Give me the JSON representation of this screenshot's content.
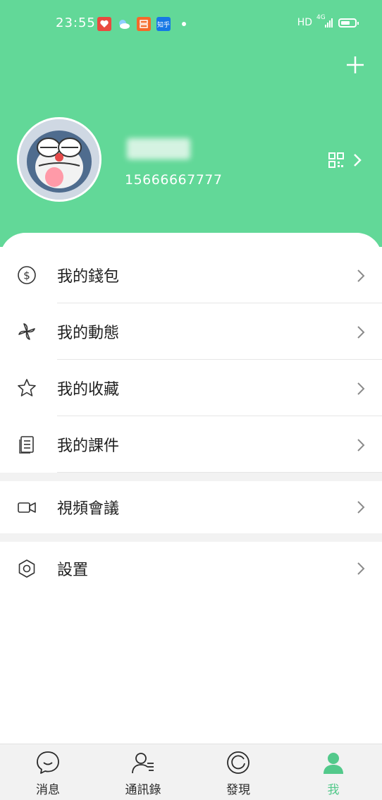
{
  "status_bar": {
    "time": "23:55",
    "notification_icons": [
      {
        "name": "red-app-icon",
        "color": "#e94a3f"
      },
      {
        "name": "weather-icon",
        "color": "#5aa8e6"
      },
      {
        "name": "orange-app-icon",
        "color": "#f46a2b"
      },
      {
        "name": "zhihu-icon",
        "label": "知乎",
        "color": "#1678e5"
      }
    ],
    "network": "HD",
    "signal_label": "4G"
  },
  "header": {
    "add_icon": "plus-icon",
    "phone": "15666667777",
    "qr_icon": "qr-code-icon",
    "chevron_icon": "chevron-right-icon",
    "background_color": "#62d898"
  },
  "menu": {
    "group1": [
      {
        "label": "我的錢包",
        "icon": "wallet-dollar-icon"
      },
      {
        "label": "我的動態",
        "icon": "pinwheel-icon"
      },
      {
        "label": "我的收藏",
        "icon": "star-icon"
      },
      {
        "label": "我的課件",
        "icon": "document-icon"
      }
    ],
    "group2": [
      {
        "label": "視頻會議",
        "icon": "video-camera-icon"
      }
    ],
    "group3": [
      {
        "label": "設置",
        "icon": "settings-hexagon-icon"
      }
    ]
  },
  "tab_bar": {
    "tabs": [
      {
        "label": "消息",
        "icon": "chat-bubble-icon",
        "active": false
      },
      {
        "label": "通訊錄",
        "icon": "contacts-icon",
        "active": false
      },
      {
        "label": "發現",
        "icon": "discover-icon",
        "active": false
      },
      {
        "label": "我",
        "icon": "profile-icon",
        "active": true
      }
    ],
    "active_color": "#53c98b"
  }
}
